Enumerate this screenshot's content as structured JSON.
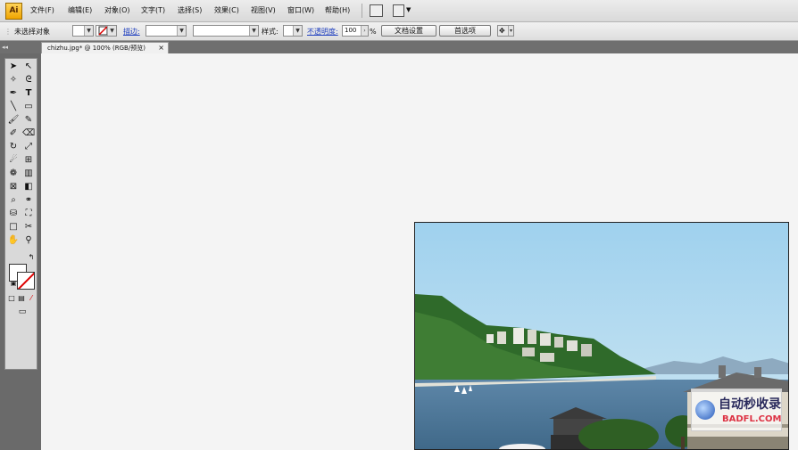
{
  "app": {
    "logo": "Ai"
  },
  "menu": [
    "文件(F)",
    "编辑(E)",
    "对象(O)",
    "文字(T)",
    "选择(S)",
    "效果(C)",
    "视图(V)",
    "窗口(W)",
    "帮助(H)"
  ],
  "control": {
    "selection_label": "未选择对象",
    "stroke_label": "描边:",
    "style_label": "样式:",
    "opacity_label": "不透明度:",
    "opacity_value": "100",
    "opacity_unit": "%",
    "doc_setup_button": "文档设置",
    "preferences_button": "首选项"
  },
  "tab": {
    "title": "chizhu.jpg* @ 100% (RGB/预览)",
    "close": "×"
  },
  "watermark": {
    "text": "自动秒收录",
    "site": "BADFL.COM"
  },
  "colors": {
    "accent": "#f0a400",
    "link": "#1f3fbf"
  }
}
